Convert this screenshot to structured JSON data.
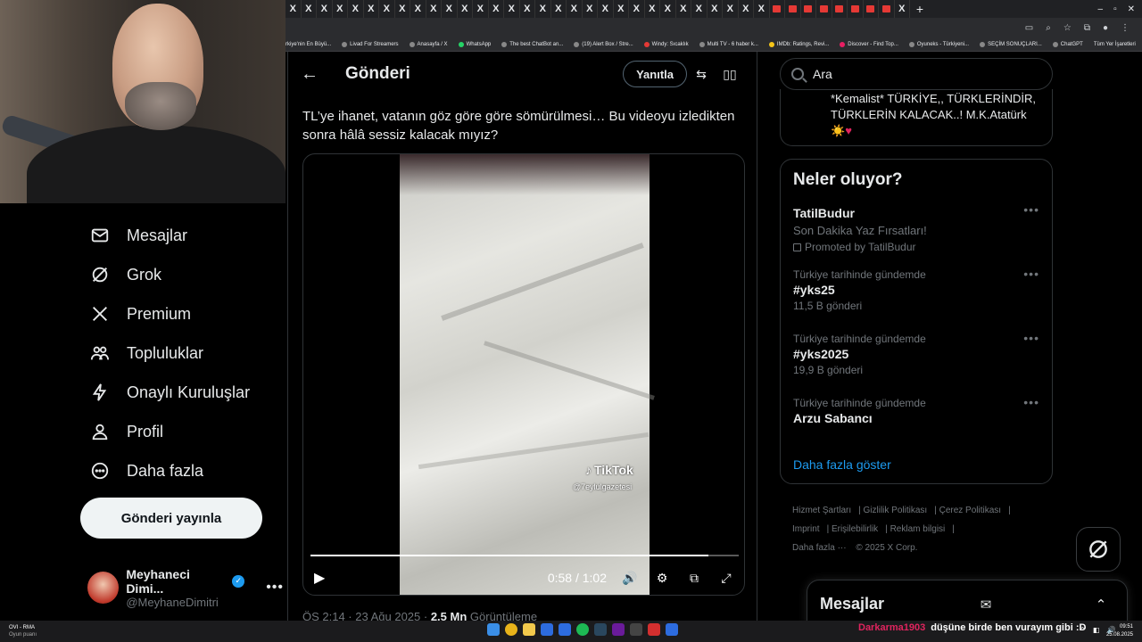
{
  "browser": {
    "new_tab": "+",
    "bookmarks": [
      "rkiye'nin En Büyü...",
      "Livad For Streamers",
      "Anasayfa / X",
      "WhatsApp",
      "The best ChatBot an...",
      "(19) Alert Box / Stre...",
      "Windy: Sıcaklık",
      "Multi TV - 6 haber k...",
      "IMDb: Ratings, Revi...",
      "Discover - Find Top...",
      "Oyuneks - Türkiyeni...",
      "SEÇİM SONUÇLARI...",
      "ChatGPT"
    ],
    "all_bookmarks": "Tüm Yer İşaretleri"
  },
  "nav": {
    "items": [
      {
        "label": "Mesajlar",
        "icon": "mail-icon"
      },
      {
        "label": "Grok",
        "icon": "grok-icon"
      },
      {
        "label": "Premium",
        "icon": "x-logo-icon"
      },
      {
        "label": "Topluluklar",
        "icon": "communities-icon"
      },
      {
        "label": "Onaylı Kuruluşlar",
        "icon": "lightning-icon"
      },
      {
        "label": "Profil",
        "icon": "person-icon"
      },
      {
        "label": "Daha fazla",
        "icon": "more-circle-icon"
      }
    ],
    "post_button": "Gönderi yayınla"
  },
  "account": {
    "name": "Meyhaneci Dimi...",
    "handle": "@MeyhaneDimitri"
  },
  "post": {
    "header_title": "Gönderi",
    "reply_button": "Yanıtla",
    "text": "TL’ye ihanet, vatanın göz göre göre sömürülmesi… Bu videoyu izledikten sonra hâlâ sessiz kalacak mıyız?",
    "video": {
      "watermark": "TikTok",
      "watermark_handle": "@7eylulgazetesi",
      "time": "0:58 / 1:02",
      "progress": 0.93
    },
    "meta_time": "ÖS 2:14 · 23 Ağu 2025 · ",
    "meta_views": "2.5 Mn",
    "meta_views_label": " Görüntüleme"
  },
  "search": {
    "placeholder": "Ara"
  },
  "previous_card": {
    "line1": "*Kemalist* TÜRKİYE,, TÜRKLERİNDİR,",
    "line2": "TÜRKLERİN KALACAK..! M.K.Atatürk",
    "emoji": "☀️",
    "heart": "♥"
  },
  "trends": {
    "title": "Neler oluyor?",
    "ad": {
      "name": "TatilBudur",
      "subtitle": "Son Dakika Yaz Fırsatları!",
      "promoted": "Promoted by TatilBudur"
    },
    "items": [
      {
        "context": "Türkiye tarihinde gündemde",
        "name": "#yks25",
        "count": "11,5 B gönderi"
      },
      {
        "context": "Türkiye tarihinde gündemde",
        "name": "#yks2025",
        "count": "19,9 B gönderi"
      },
      {
        "context": "Türkiye tarihinde gündemde",
        "name": "Arzu Sabancı",
        "count": ""
      }
    ],
    "show_more": "Daha fazla göster"
  },
  "footer": {
    "links": [
      "Hizmet Şartları",
      "Gizlilik Politikası",
      "Çerez Politikası",
      "Imprint",
      "Erişilebilirlik",
      "Reklam bilgisi",
      "Daha fazla ···"
    ],
    "copyright": "© 2025 X Corp."
  },
  "messages_drawer": {
    "title": "Mesajlar"
  },
  "taskbar": {
    "weather_line1": "OVI - RMA",
    "weather_line2": "Oyun puanı",
    "time": "09:51",
    "date": "25.08.2025"
  },
  "chat_overlay": {
    "user": "Darkarma1903",
    "message": "düşüne birde ben vurayım gibi :D"
  }
}
